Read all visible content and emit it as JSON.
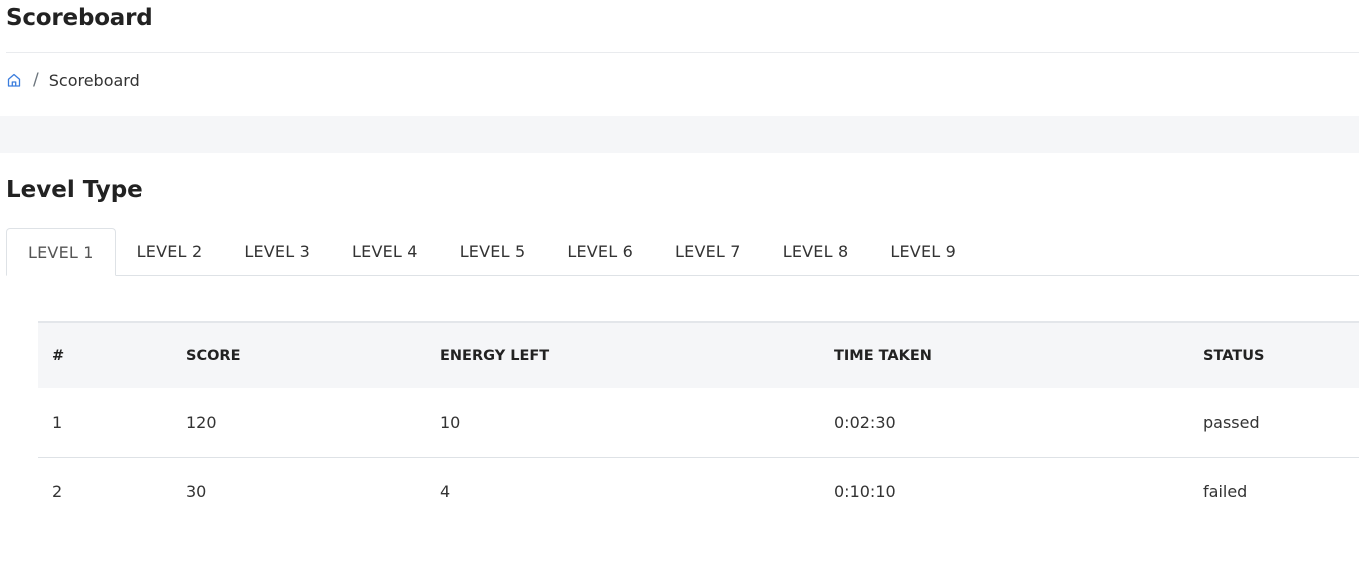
{
  "header": {
    "title": "Scoreboard"
  },
  "breadcrumb": {
    "home_icon": "home-icon",
    "separator": "/",
    "current": "Scoreboard"
  },
  "section": {
    "title": "Level Type"
  },
  "tabs": [
    {
      "label": "LEVEL 1",
      "active": true
    },
    {
      "label": "LEVEL 2",
      "active": false
    },
    {
      "label": "LEVEL 3",
      "active": false
    },
    {
      "label": "LEVEL 4",
      "active": false
    },
    {
      "label": "LEVEL 5",
      "active": false
    },
    {
      "label": "LEVEL 6",
      "active": false
    },
    {
      "label": "LEVEL 7",
      "active": false
    },
    {
      "label": "LEVEL 8",
      "active": false
    },
    {
      "label": "LEVEL 9",
      "active": false
    }
  ],
  "table": {
    "columns": [
      "#",
      "SCORE",
      "ENERGY LEFT",
      "TIME TAKEN",
      "STATUS"
    ],
    "rows": [
      [
        "1",
        "120",
        "10",
        "0:02:30",
        "passed"
      ],
      [
        "2",
        "30",
        "4",
        "0:10:10",
        "failed"
      ]
    ]
  },
  "colors": {
    "accent": "#3b7ddd",
    "header_bg": "#f5f6f8"
  }
}
